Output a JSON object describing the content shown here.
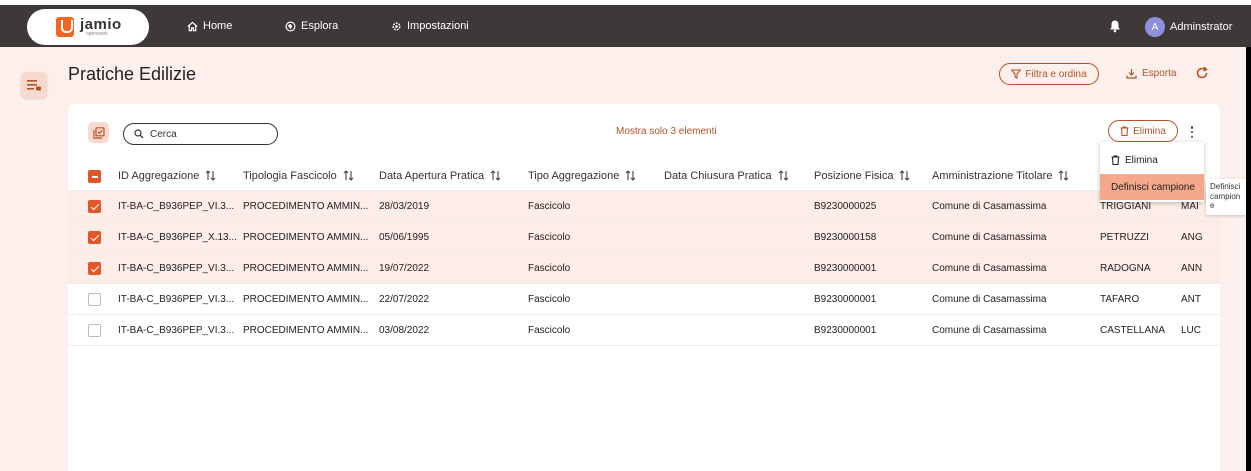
{
  "navbar": {
    "logo_name": "jamio",
    "logo_sub": "openwork",
    "items": [
      {
        "label": "Home",
        "icon": "home-icon"
      },
      {
        "label": "Esplora",
        "icon": "explore-icon"
      },
      {
        "label": "Impostazioni",
        "icon": "gear-icon"
      }
    ],
    "avatar_initial": "A",
    "user_name": "Adminstrator"
  },
  "page": {
    "title": "Pratiche Edilizie",
    "filter_label": "Filtra e ordina",
    "export_label": "Esporta"
  },
  "toolbar": {
    "search_placeholder": "Cerca",
    "show_only": "Mostra solo 3 elementi",
    "delete_label": "Elimina"
  },
  "table": {
    "columns": [
      "ID Aggregazione",
      "Tipologia Fascicolo",
      "Data Apertura Pratica",
      "Tipo Aggregazione",
      "Data Chiusura Pratica",
      "Posizione Fisica",
      "Amministrazione Titolare",
      ""
    ],
    "rows": [
      {
        "checked": true,
        "cells": [
          "IT-BA-C_B936PEP_VI.3...",
          "PROCEDIMENTO AMMIN...",
          "28/03/2019",
          "Fascicolo",
          "",
          "B9230000025",
          "Comune di Casamassima",
          "TRIGGIANI",
          "MAI"
        ]
      },
      {
        "checked": true,
        "cells": [
          "IT-BA-C_B936PEP_X.13...",
          "PROCEDIMENTO AMMIN...",
          "05/06/1995",
          "Fascicolo",
          "",
          "B9230000158",
          "Comune di Casamassima",
          "PETRUZZI",
          "ANG"
        ]
      },
      {
        "checked": true,
        "cells": [
          "IT-BA-C_B936PEP_VI.3...",
          "PROCEDIMENTO AMMIN...",
          "19/07/2022",
          "Fascicolo",
          "",
          "B9230000001",
          "Comune di Casamassima",
          "RADOGNA",
          "ANN"
        ]
      },
      {
        "checked": false,
        "cells": [
          "IT-BA-C_B936PEP_VI.3...",
          "PROCEDIMENTO AMMIN...",
          "22/07/2022",
          "Fascicolo",
          "",
          "B9230000001",
          "Comune di Casamassima",
          "TAFARO",
          "ANT"
        ]
      },
      {
        "checked": false,
        "cells": [
          "IT-BA-C_B936PEP_VI.3...",
          "PROCEDIMENTO AMMIN...",
          "03/08/2022",
          "Fascicolo",
          "",
          "B9230000001",
          "Comune di Casamassima",
          "CASTELLANA",
          "LUC"
        ]
      }
    ]
  },
  "dropdown": {
    "items": [
      {
        "label": "Elimina",
        "active": false
      },
      {
        "label": "Definisci campione",
        "active": true
      }
    ],
    "tooltip": "Definisci campione"
  },
  "colors": {
    "accent": "#e0582a",
    "navbar": "#3f3838",
    "background": "#fdf0ec"
  }
}
